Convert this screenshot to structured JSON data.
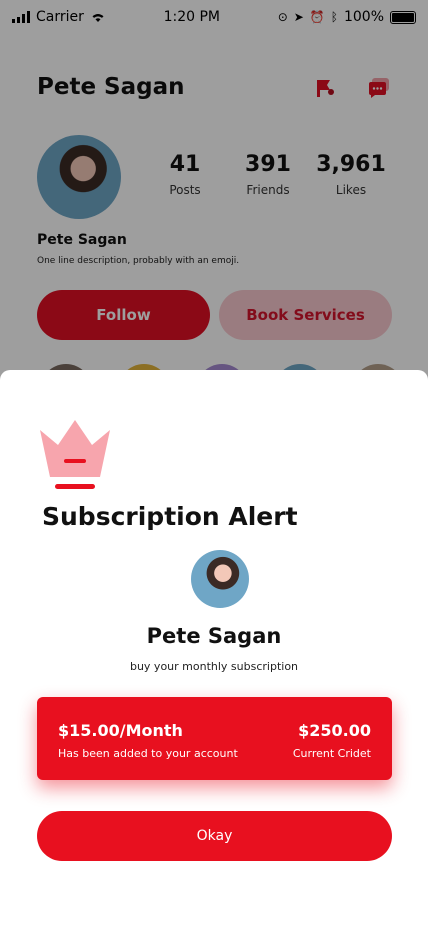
{
  "status_bar": {
    "carrier": "Carrier",
    "time": "1:20 PM",
    "battery": "100%"
  },
  "profile": {
    "name": "Pete Sagan",
    "bio_name": "Pete Sagan",
    "bio": "One line description, probably with an emoji.",
    "stats": [
      {
        "value": "41",
        "label": "Posts"
      },
      {
        "value": "391",
        "label": "Friends"
      },
      {
        "value": "3,961",
        "label": "Likes"
      }
    ],
    "follow_label": "Follow",
    "book_label": "Book Services",
    "icons": [
      "flag-icon",
      "message-icon"
    ]
  },
  "sheet": {
    "title": "Subscription Alert",
    "name": "Pete Sagan",
    "subtitle": "buy your monthly subscription",
    "price": {
      "amount": "$15.00/Month",
      "note": "Has been added to your account",
      "credit": "$250.00",
      "credit_label": "Current Cridet"
    },
    "okay_label": "Okay"
  },
  "colors": {
    "accent": "#e8101f",
    "accent_light": "#f9c9cf",
    "crown": "#f7a5ad"
  }
}
